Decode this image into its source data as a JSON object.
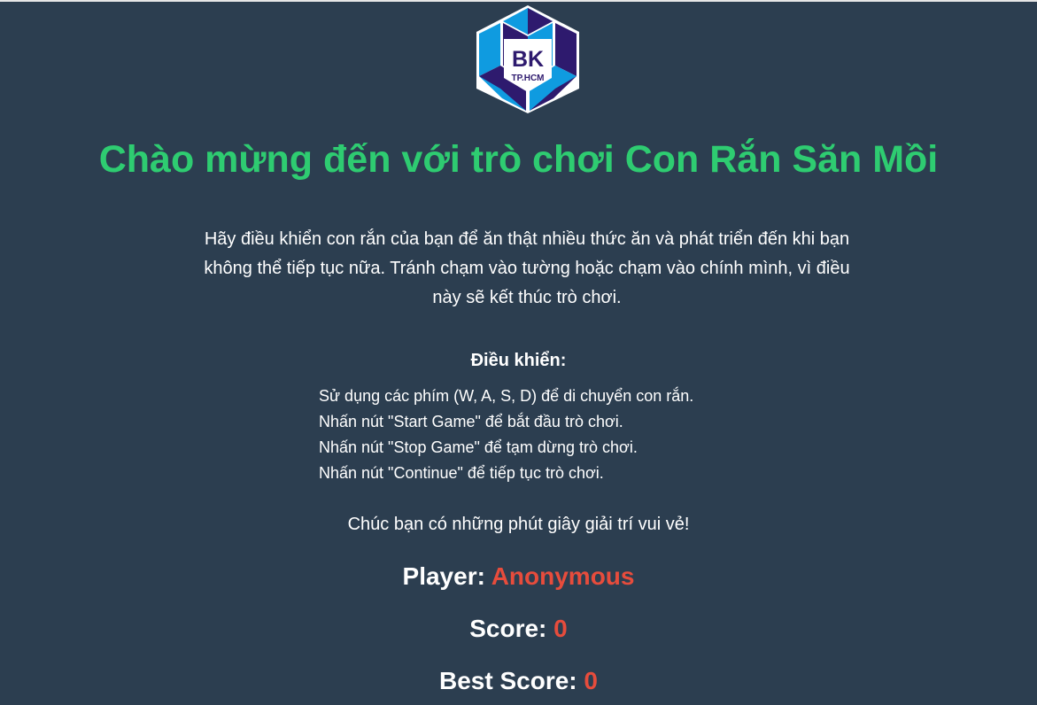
{
  "logo": {
    "text_main": "BK",
    "text_sub": "TP.HCM",
    "colors": {
      "dark": "#2e1a6e",
      "light": "#0f9be0",
      "outline": "#ffffff"
    }
  },
  "header": {
    "title": "Chào mừng đến với trò chơi Con Rắn Săn Mồi"
  },
  "intro": {
    "text": "Hãy điều khiển con rắn của bạn để ăn thật nhiều thức ăn và phát triển đến khi bạn không thể tiếp tục nữa. Tránh chạm vào tường hoặc chạm vào chính mình, vì điều này sẽ kết thúc trò chơi."
  },
  "controls": {
    "heading": "Điều khiển:",
    "items": [
      "Sử dụng các phím (W, A, S, D) để di chuyển con rắn.",
      "Nhấn nút \"Start Game\" để bắt đầu trò chơi.",
      "Nhấn nút \"Stop Game\" để tạm dừng trò chơi.",
      "Nhấn nút \"Continue\" để tiếp tục trò chơi."
    ]
  },
  "closing": {
    "text": "Chúc bạn có những phút giây giải trí vui vẻ!"
  },
  "stats": {
    "player_label": "Player:",
    "player_value": "Anonymous",
    "score_label": "Score:",
    "score_value": "0",
    "best_label": "Best Score:",
    "best_value": "0"
  },
  "theme": {
    "background": "#2c3e50",
    "title_color": "#2ecc71",
    "accent_color": "#e74c3c",
    "text_color": "#ffffff"
  }
}
